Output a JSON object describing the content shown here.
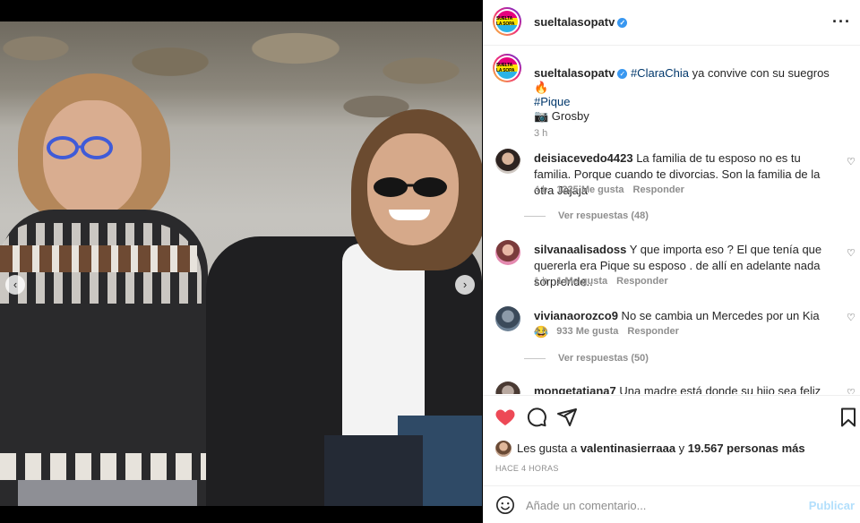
{
  "header": {
    "username": "sueltalasopatv",
    "avatar_text": "SUELTA LA SOPA"
  },
  "caption": {
    "username": "sueltalasopatv",
    "tag1": "#ClaraChia",
    "text": " ya convive con su suegros 🔥",
    "tag2": "#Pique",
    "credit": "📷 Grosby",
    "time": "3 h"
  },
  "comments": [
    {
      "username": "deisiacevedo4423",
      "text": " La familia de tu esposo no es tu familia. Porque cuando te divorcias. Son la familia de la otra Jajaja",
      "time": "4 h",
      "likes": "1225 Me gusta",
      "reply": "Responder",
      "view_replies": "Ver respuestas (48)"
    },
    {
      "username": "silvanaalisadoss",
      "text": " Y que importa eso ? El que tenía que quererla era Pique su esposo . de allí en adelante nada sorprende..",
      "time": "1 h",
      "likes": "1 Me gusta",
      "reply": "Responder"
    },
    {
      "username": "vivianaorozco9",
      "text": " No se cambia un Mercedes por un Kia 😂",
      "time": "4 h",
      "likes": "933 Me gusta",
      "reply": "Responder",
      "view_replies": "Ver respuestas (50)"
    },
    {
      "username": "mongetatiana7",
      "text": " Una madre está donde su hijo sea feliz"
    }
  ],
  "likes": {
    "prefix": "Les gusta a ",
    "user": "valentinasierraaa",
    "middle": " y ",
    "count": "19.567 personas más"
  },
  "post_time": "HACE 4 HORAS",
  "composer": {
    "placeholder": "Añade un comentario...",
    "publish_label": "Publicar"
  },
  "media": {
    "slide_count": 5,
    "active_slide": 3
  },
  "colors": {
    "like_red": "#ed4956",
    "link_blue": "#00376b",
    "verified_blue": "#3897f0",
    "publish_disabled": "#b2dffc"
  }
}
